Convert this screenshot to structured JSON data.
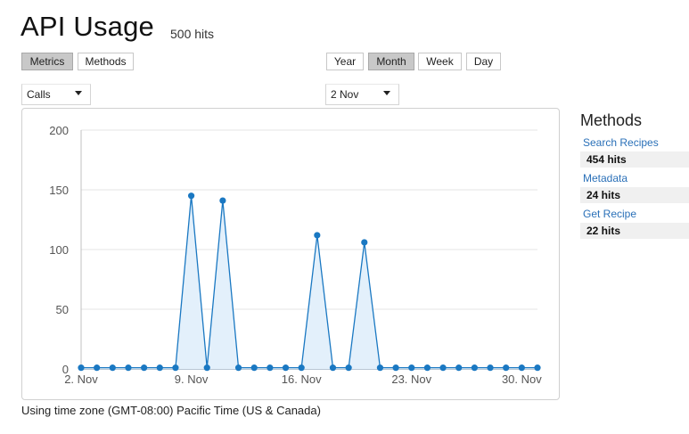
{
  "header": {
    "title": "API Usage",
    "total_hits": "500 hits"
  },
  "view_toggle": {
    "metrics": "Metrics",
    "methods": "Methods"
  },
  "period_toggle": {
    "year": "Year",
    "month": "Month",
    "week": "Week",
    "day": "Day"
  },
  "filters": {
    "metric_select": "Calls",
    "date_select": "2 Nov"
  },
  "footer": {
    "timezone_note": "Using time zone (GMT-08:00) Pacific Time (US & Canada)"
  },
  "methods_panel": {
    "title": "Methods",
    "items": [
      {
        "name": "Search Recipes",
        "hits": "454 hits"
      },
      {
        "name": "Metadata",
        "hits": "24 hits"
      },
      {
        "name": "Get Recipe",
        "hits": "22 hits"
      }
    ]
  },
  "colors": {
    "series": "#1a78c2",
    "fill": "#e3f0fb",
    "active_button": "#c8c8c8",
    "link": "#2a70b8"
  },
  "chart_data": {
    "type": "area",
    "x_unit": "day of November",
    "x": [
      2,
      3,
      4,
      5,
      6,
      7,
      8,
      9,
      10,
      11,
      12,
      13,
      14,
      15,
      16,
      17,
      18,
      19,
      20,
      21,
      22,
      23,
      24,
      25,
      26,
      27,
      28,
      29,
      30,
      31
    ],
    "series": [
      {
        "values": [
          1,
          1,
          1,
          1,
          1,
          1,
          1,
          145,
          1,
          141,
          1,
          1,
          1,
          1,
          1,
          112,
          1,
          1,
          106,
          1,
          1,
          1,
          1,
          1,
          1,
          1,
          1,
          1,
          1,
          1
        ]
      }
    ],
    "xticks": [
      {
        "x": 2,
        "label": "2. Nov"
      },
      {
        "x": 9,
        "label": "9. Nov"
      },
      {
        "x": 16,
        "label": "16. Nov"
      },
      {
        "x": 23,
        "label": "23. Nov"
      },
      {
        "x": 30,
        "label": "30. Nov"
      }
    ],
    "yticks": [
      "0",
      "50",
      "100",
      "150",
      "200"
    ],
    "xlim": [
      2,
      31
    ],
    "ylim": [
      0,
      200
    ],
    "grid": true
  }
}
